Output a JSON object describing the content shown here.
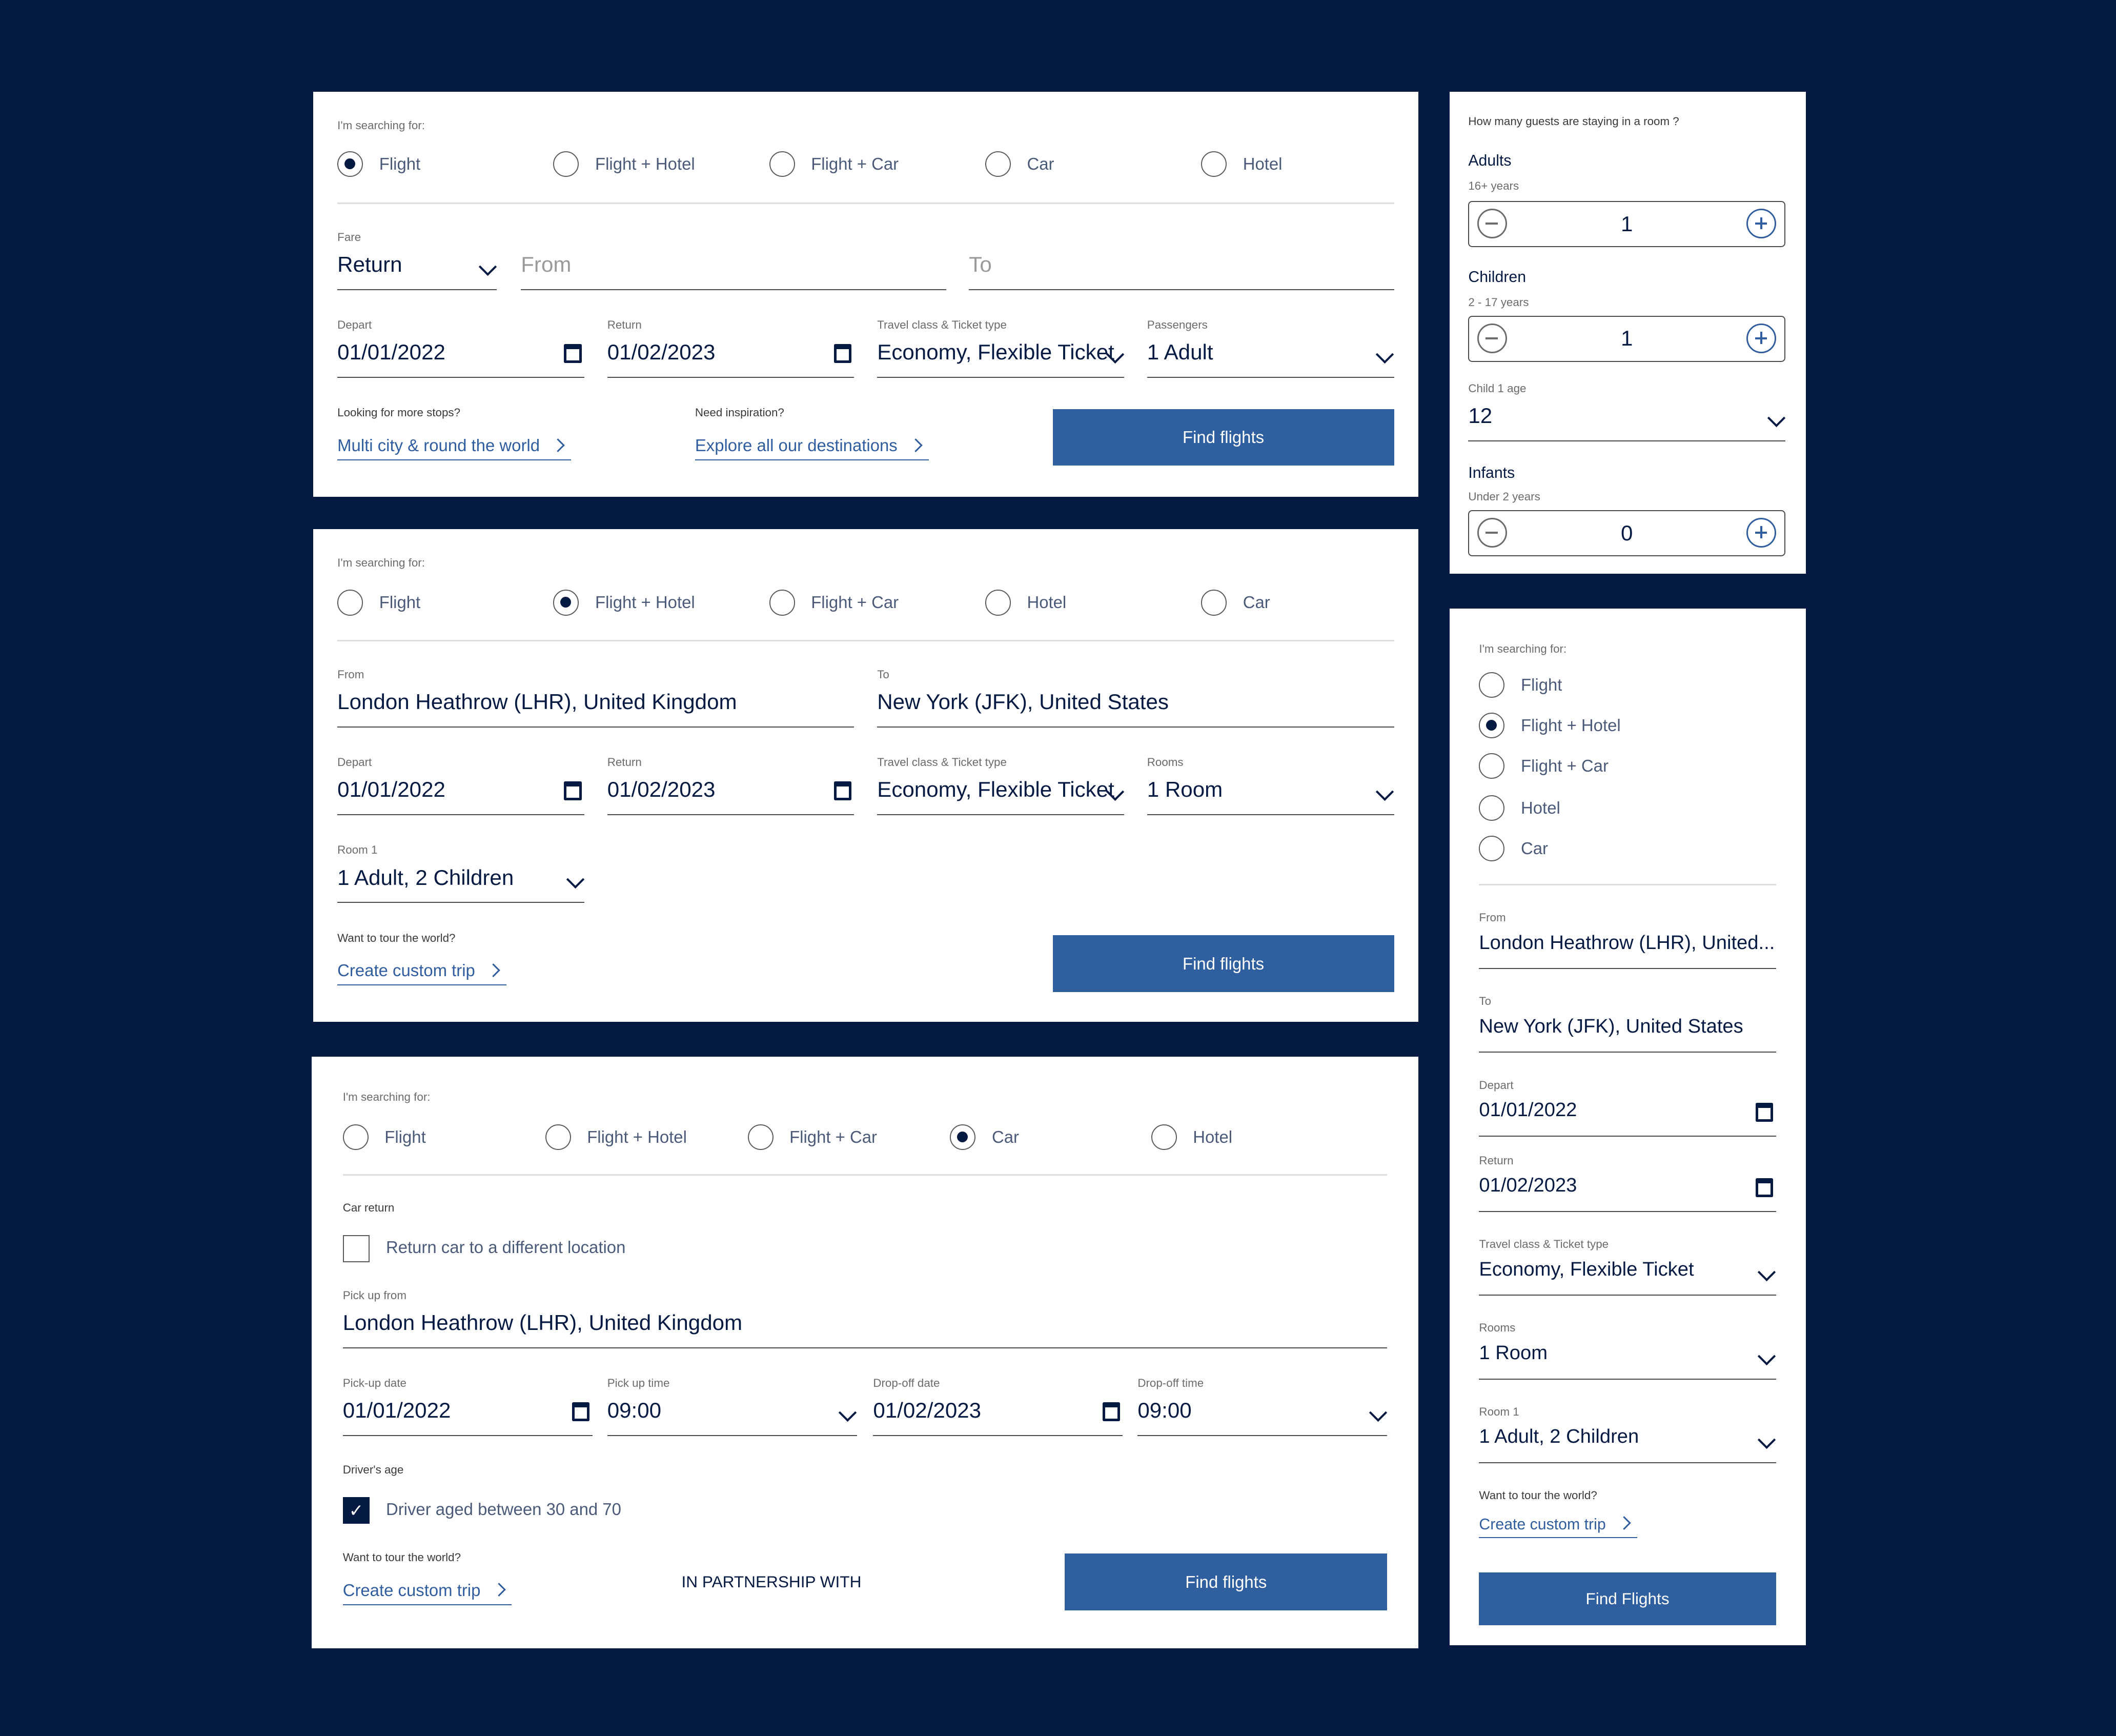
{
  "common": {
    "searching_for": "I'm searching for:",
    "find_flights": "Find flights",
    "depart": "Depart",
    "return": "Return",
    "travel_class": "Travel class & Ticket type",
    "economy": "Economy, Flexible Ticket",
    "date_depart": "01/01/2022",
    "date_return": "01/02/2023",
    "lhr_full": "London Heathrow (LHR), United Kingdom",
    "jfk": "New York (JFK), United States",
    "want_tour": "Want to tour the world?",
    "create_trip": "Create custom trip",
    "opt_flight": "Flight",
    "opt_flight_hotel": "Flight + Hotel",
    "opt_flight_car": "Flight + Car",
    "opt_car": "Car",
    "opt_hotel": "Hotel"
  },
  "card1": {
    "fare_label": "Fare",
    "fare_value": "Return",
    "from_placeholder": "From",
    "to_placeholder": "To",
    "passengers_label": "Passengers",
    "passengers_value": "1 Adult",
    "more_stops": "Looking for more stops?",
    "multi_city": "Multi city & round the world",
    "need_inspiration": "Need inspiration?",
    "explore": "Explore all our destinations"
  },
  "card2": {
    "from_label": "From",
    "to_label": "To",
    "rooms_label": "Rooms",
    "rooms_value": "1 Room",
    "room1_label": "Room 1",
    "room1_value": "1 Adult, 2 Children"
  },
  "card3": {
    "car_return": "Car return",
    "return_diff": "Return car to a different location",
    "pickup_from": "Pick up from",
    "pickup_date": "Pick-up date",
    "pickup_time": "Pick up time",
    "dropoff_date": "Drop-off date",
    "dropoff_time": "Drop-off time",
    "time_value": "09:00",
    "drivers_age": "Driver's age",
    "driver_aged": "Driver aged between 30 and 70",
    "partnership": "IN PARTNERSHIP WITH"
  },
  "guests": {
    "question": "How many guests are staying  in  a room ?",
    "adults": "Adults",
    "adults_sub": "16+ years",
    "adults_value": "1",
    "children": "Children",
    "children_sub": "2 - 17 years",
    "children_value": "1",
    "child_age_label": "Child 1 age",
    "child_age_value": "12",
    "infants": "Infants",
    "infants_sub": "Under 2 years",
    "infants_value": "0"
  },
  "mobile": {
    "from_label": "From",
    "from_value": "London Heathrow (LHR), United...",
    "to_label": "To",
    "rooms_label": "Rooms",
    "rooms_value": "1 Room",
    "room1_label": "Room 1",
    "room1_value": "1 Adult, 2 Children",
    "find_flights": "Find Flights"
  }
}
